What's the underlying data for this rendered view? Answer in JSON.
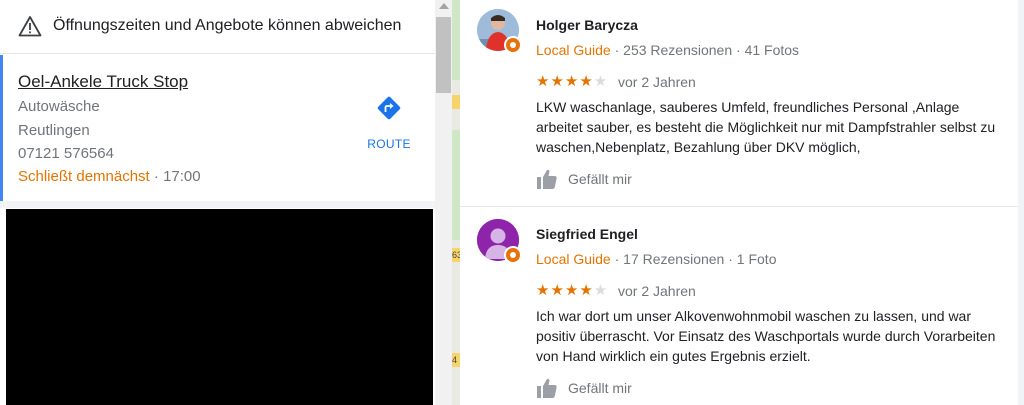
{
  "notice": {
    "text": "Öffnungszeiten und Angebote können abweichen",
    "icon": "warning-icon"
  },
  "place": {
    "name": "Oel-Ankele Truck Stop",
    "category": "Autowäsche",
    "city": "Reutlingen",
    "phone": "07121 576564",
    "closing_label": "Schließt demnächst",
    "closing_separator": " · ",
    "closing_time": "17:00",
    "route_label": "ROUTE",
    "route_icon": "directions-icon"
  },
  "reviews": [
    {
      "name": "Holger Barycza",
      "guide_label": "Local Guide",
      "stats": " · 253 Rezensionen · 41 Fotos",
      "rating": 4,
      "date": "vor 2 Jahren",
      "text_lines": [
        "LKW waschanlage, sauberes Umfeld, freundliches Personal ,Anlage",
        "arbeitet sauber, es besteht die Möglichkeit nur mit Dampfstrahler selbst zu",
        "waschen,Nebenplatz, Bezahlung über DKV möglich,"
      ],
      "like_label": "Gefällt mir"
    },
    {
      "name": "Siegfried Engel",
      "guide_label": "Local Guide",
      "stats": " · 17 Rezensionen · 1 Foto",
      "rating": 4,
      "date": "vor 2 Jahren",
      "text_lines": [
        "Ich war dort um unser Alkovenwohnmobil waschen zu lassen, und war",
        "positiv überrascht. Vor Einsatz des Waschportals wurde durch Vorarbeiten",
        "von Hand wirklich ein gutes Ergebnis erzielt."
      ],
      "like_label": "Gefällt mir"
    }
  ],
  "map": {
    "labels": [
      "63",
      "4"
    ]
  },
  "colors": {
    "accent_blue": "#1a73e8",
    "guide_orange": "#e37400",
    "star_orange": "#e37400"
  }
}
